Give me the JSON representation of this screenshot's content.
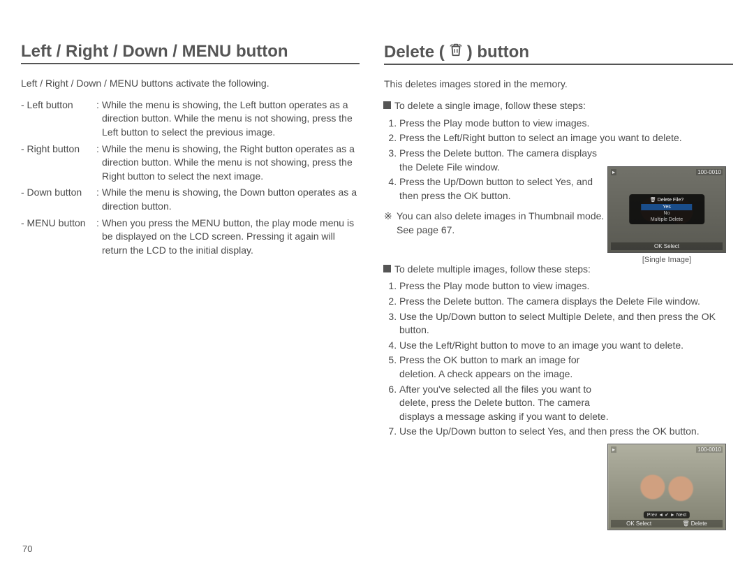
{
  "page_number": "70",
  "left": {
    "heading": "Left / Right / Down / MENU button",
    "intro": "Left / Right / Down / MENU buttons activate the following.",
    "defs": [
      {
        "term": "- Left button",
        "desc": "While the menu is showing, the Left button operates as a direction button. While the menu is not showing, press the Left button to select the previous image."
      },
      {
        "term": "- Right button",
        "desc": "While the menu is showing, the Right button operates as a direction button. While the menu is not showing, press the Right button to select the next image."
      },
      {
        "term": "- Down button",
        "desc": "While the menu is showing, the Down button operates as a direction button."
      },
      {
        "term": "- MENU button",
        "desc": "When you press the MENU button, the play mode menu is be displayed on the LCD screen. Pressing it again will return the LCD to the initial display."
      }
    ]
  },
  "right": {
    "heading_pre": "Delete (",
    "heading_post": ") button",
    "intro": "This deletes images stored in the memory.",
    "single": {
      "subhead": "To delete a single image, follow these steps:",
      "steps": [
        "Press the Play mode button to view images.",
        "Press the Left/Right button to select an image you want to delete.",
        "Press the Delete button. The camera displays the Delete File window.",
        "Press the Up/Down button to select Yes, and then press the OK button."
      ],
      "note": "You can also delete images in Thumbnail mode. See page 67.",
      "figure": {
        "file_no": "100-0010",
        "dialog_title": "Delete File?",
        "opt_yes": "Yes",
        "opt_no": "No",
        "opt_multi": "Multiple Delete",
        "bottom": "OK  Select",
        "caption": "[Single Image]"
      }
    },
    "multi": {
      "subhead": "To delete multiple images, follow these steps:",
      "steps": [
        "Press the Play mode button to view images.",
        "Press the Delete button. The camera displays the Delete File window.",
        "Use the Up/Down button to select Multiple Delete, and then press the OK button.",
        "Use the Left/Right button to move to an image you want to delete.",
        "Press the OK button to mark an image for deletion. A check appears on the image.",
        "After you've selected all the files you want to delete, press the Delete button. The camera displays a message asking if you want to delete.",
        "Use the Up/Down button to select Yes, and then press the OK button."
      ],
      "figure": {
        "file_no": "100-0010",
        "midnav": "Prev  ◄  ✔  ►  Next",
        "bottom_left": "OK  Select",
        "bottom_right": "🗑  Delete"
      }
    }
  }
}
